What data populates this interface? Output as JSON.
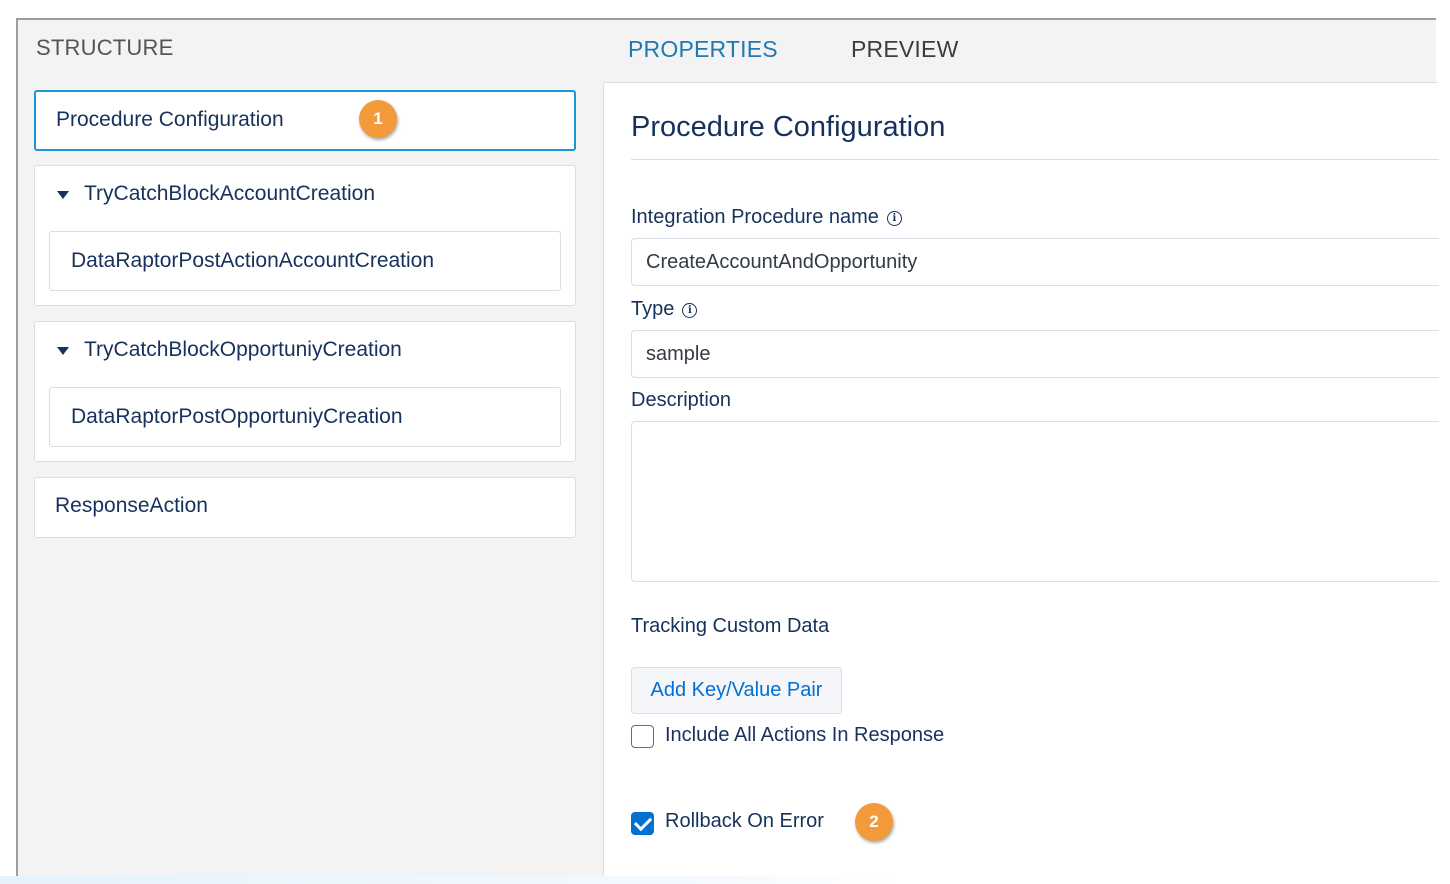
{
  "structure": {
    "title": "STRUCTURE",
    "selected_node": {
      "label": "Procedure Configuration",
      "badge": "1"
    },
    "groups": [
      {
        "label": "TryCatchBlockAccountCreation",
        "child": "DataRaptorPostActionAccountCreation"
      },
      {
        "label": "TryCatchBlockOpportuniyCreation",
        "child": "DataRaptorPostOpportuniyCreation"
      }
    ],
    "response_node": "ResponseAction"
  },
  "tabs": {
    "properties": "PROPERTIES",
    "preview": "PREVIEW"
  },
  "properties": {
    "title": "Procedure Configuration",
    "name_label": "Integration Procedure name",
    "name_value": "CreateAccountAndOpportunity",
    "type_label": "Type",
    "type_value": "sample",
    "description_label": "Description",
    "description_value": "",
    "tracking_label": "Tracking Custom Data",
    "add_pair_button": "Add Key/Value Pair",
    "include_all_label": "Include All Actions In Response",
    "include_all_checked": false,
    "rollback_label": "Rollback On Error",
    "rollback_checked": true,
    "rollback_badge": "2"
  },
  "colors": {
    "active_tab": "#1f79b3",
    "selected_border": "#1b96d9",
    "badge": "#f39a3b",
    "checkbox_checked": "#0070d2"
  },
  "icons": {
    "info": "info-circle-icon",
    "expand": "caret-down-icon"
  }
}
